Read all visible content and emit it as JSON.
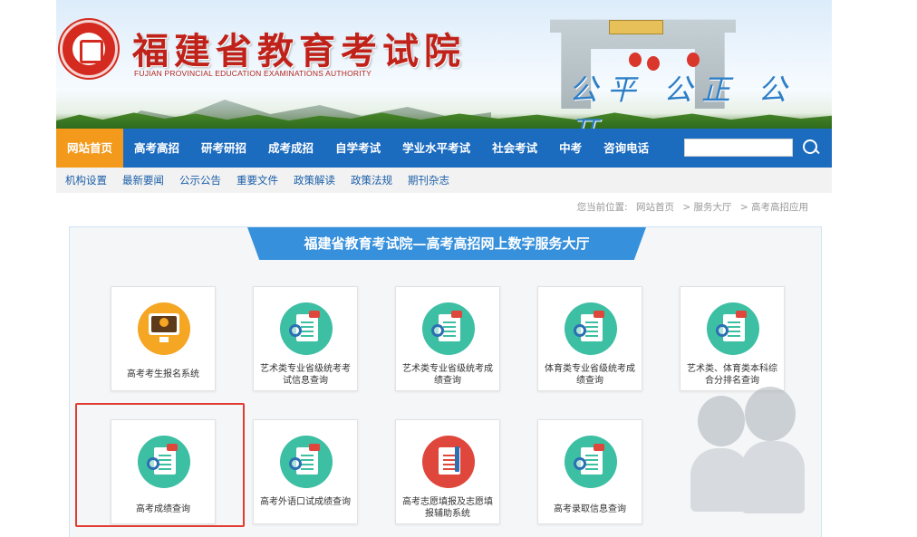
{
  "header": {
    "title": "福建省教育考试院",
    "subtitle": "FUJIAN PROVINCIAL EDUCATION EXAMINATIONS AUTHORITY",
    "slogan": "公平 公正 公开",
    "logo_icon": "seal-logo-icon"
  },
  "main_nav": {
    "items": [
      {
        "label": "网站首页",
        "active": true
      },
      {
        "label": "高考高招",
        "active": false
      },
      {
        "label": "研考研招",
        "active": false
      },
      {
        "label": "成考成招",
        "active": false
      },
      {
        "label": "自学考试",
        "active": false
      },
      {
        "label": "学业水平考试",
        "active": false
      },
      {
        "label": "社会考试",
        "active": false
      },
      {
        "label": "中考",
        "active": false
      },
      {
        "label": "咨询电话",
        "active": false
      }
    ],
    "search_value": "",
    "search_icon": "search-icon",
    "active_color": "#f39a1c",
    "bar_color": "#1b6bbf"
  },
  "sub_nav": {
    "items": [
      "机构设置",
      "最新要闻",
      "公示公告",
      "重要文件",
      "政策解读",
      "政策法规",
      "期刊杂志"
    ]
  },
  "breadcrumb": {
    "prefix": "您当前位置:",
    "items": [
      "网站首页",
      "> 服务大厅",
      "> 高考高招应用"
    ]
  },
  "panel": {
    "title": "福建省教育考试院—高考高招网上数字服务大厅",
    "cards": [
      {
        "label": "高考考生报名系统",
        "icon": "computer-upload-icon"
      },
      {
        "label": "艺术类专业省级统考考试信息查询",
        "icon": "score-query-icon"
      },
      {
        "label": "艺术类专业省级统考成绩查询",
        "icon": "score-query-icon"
      },
      {
        "label": "体育类专业省级统考成绩查询",
        "icon": "score-query-icon"
      },
      {
        "label": "艺术类、体育类本科综合分排名查询",
        "icon": "score-query-icon"
      },
      {
        "label": "高考成绩查询",
        "icon": "score-query-icon"
      },
      {
        "label": "高考外语口试成绩查询",
        "icon": "score-query-icon"
      },
      {
        "label": "高考志愿填报及志愿填报辅助系统",
        "icon": "application-form-icon"
      },
      {
        "label": "高考录取信息查询",
        "icon": "score-query-icon"
      }
    ],
    "highlighted_card": "高考成绩查询",
    "highlight_color": "#e23b32"
  },
  "decorations": {
    "mascot_icon": "customer-service-mascot-icon"
  }
}
